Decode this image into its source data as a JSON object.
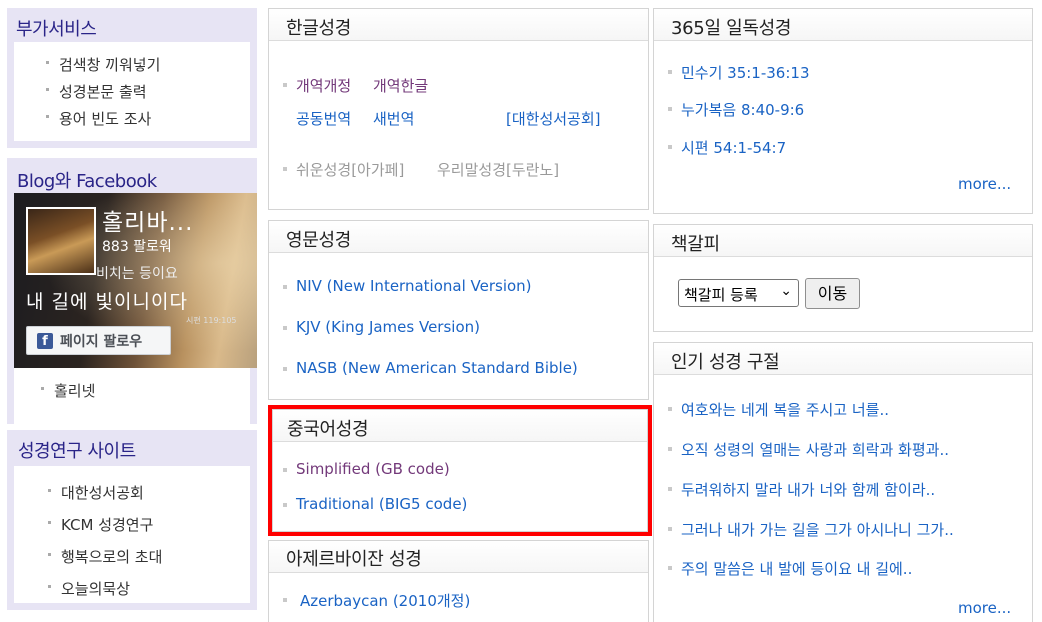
{
  "left": {
    "services": {
      "title": "부가서비스",
      "items": [
        "검색창 끼워넣기",
        "성경본문 출력",
        "용어 빈도 조사"
      ]
    },
    "blog": {
      "title": "Blog와 Facebook",
      "page_name": "홀리바...",
      "followers": "883 팔로워",
      "follow_button": "페이지 팔로우",
      "fb_letter": "f",
      "caption_line1": "비치는 등이요",
      "caption_line2": "내 길에 빛이니이다",
      "caption_ref": "시편 119:105",
      "items": [
        "홀리넷"
      ]
    },
    "research": {
      "title": "성경연구 사이트",
      "items": [
        "대한성서공회",
        "KCM 성경연구",
        "행복으로의 초대",
        "오늘의묵상"
      ]
    }
  },
  "middle": {
    "korean": {
      "title": "한글성경",
      "links": [
        {
          "label": "개역개정",
          "color": "purple"
        },
        {
          "label": "개역한글",
          "color": "purple"
        },
        {
          "label": "공동번역",
          "color": "blue"
        },
        {
          "label": "새번역",
          "color": "blue"
        },
        {
          "label": "[대한성서공회]",
          "color": "blue"
        },
        {
          "label": "쉬운성경[아가페]",
          "color": "gray"
        },
        {
          "label": "우리말성경[두란노]",
          "color": "gray"
        }
      ]
    },
    "english": {
      "title": "영문성경",
      "links": [
        "NIV (New International Version)",
        "KJV (King James Version)",
        "NASB (New American Standard Bible)"
      ]
    },
    "chinese": {
      "title": "중국어성경",
      "links": [
        "Simplified (GB code)",
        "Traditional (BIG5 code)"
      ]
    },
    "azerbaijani": {
      "title": "아제르바이잔 성경",
      "links": [
        "Azerbaycan (2010개정)"
      ]
    }
  },
  "right": {
    "daily": {
      "title": "365일 일독성경",
      "items": [
        "민수기 35:1-36:13",
        "누가복음 8:40-9:6",
        "시편 54:1-54:7"
      ],
      "more": "more..."
    },
    "bookmark": {
      "title": "책갈피",
      "select_value": "책갈피 등록",
      "go_button": "이동"
    },
    "popular": {
      "title": "인기 성경 구절",
      "items": [
        "여호와는 네게 복을 주시고 너를..",
        "오직 성령의 열매는 사랑과 희락과 화평과..",
        "두려워하지 말라 내가 너와 함께 함이라..",
        "그러나 내가 가는 길을 그가 아시나니 그가..",
        "주의 말씀은 내 발에 등이요 내 길에.."
      ],
      "more": "more..."
    }
  },
  "colors": {
    "highlight_border": "#ff0000",
    "link_blue": "#1a63c4",
    "link_purple": "#73397a",
    "sidebar_bg": "#e7e4f4",
    "sidebar_title": "#2a2488"
  }
}
